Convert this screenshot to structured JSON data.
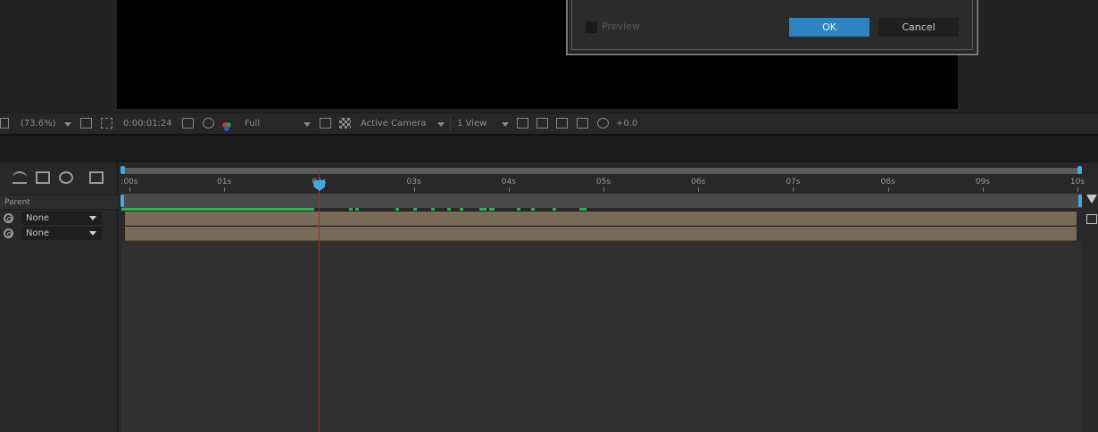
{
  "dialog": {
    "preview_label": "Preview",
    "ok_label": "OK",
    "cancel_label": "Cancel"
  },
  "viewer_toolbar": {
    "zoom": "(73.6%)",
    "timecode": "0:00:01:24",
    "resolution": "Full",
    "camera": "Active Camera",
    "view_layout": "1 View",
    "exposure": "+0.0"
  },
  "timeline": {
    "column_header": "Parent",
    "ruler_labels": [
      ":00s",
      "01s",
      "02s",
      "03s",
      "04s",
      "05s",
      "06s",
      "07s",
      "08s",
      "09s",
      "10s"
    ],
    "layers": [
      {
        "parent": "None"
      },
      {
        "parent": "None"
      }
    ],
    "current_time_seconds": 2.0,
    "duration_seconds": 10
  },
  "colors": {
    "accent": "#2d84c0",
    "playhead": "#b02424",
    "layer_bar": "#7a6a58",
    "keyframe_green": "#39a85a"
  }
}
